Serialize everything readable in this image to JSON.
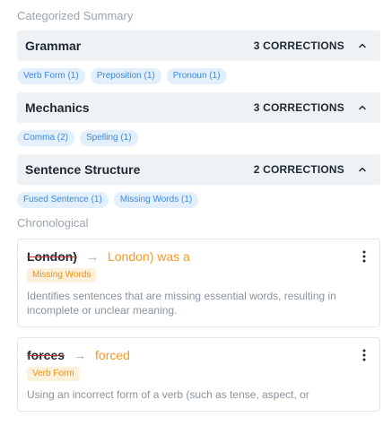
{
  "summary": {
    "heading": "Categorized Summary",
    "categories": [
      {
        "title": "Grammar",
        "count": "3 CORRECTIONS",
        "chips": [
          "Verb Form (1)",
          "Preposition (1)",
          "Pronoun (1)"
        ]
      },
      {
        "title": "Mechanics",
        "count": "3 CORRECTIONS",
        "chips": [
          "Comma (2)",
          "Spelling (1)"
        ]
      },
      {
        "title": "Sentence Structure",
        "count": "2 CORRECTIONS",
        "chips": [
          "Fused Sentence (1)",
          "Missing Words (1)"
        ]
      }
    ]
  },
  "chronological": {
    "heading": "Chronological",
    "items": [
      {
        "original": "London)",
        "replacement": "London) was a",
        "tag": "Missing Words",
        "description": "Identifies sentences that are missing essential words, resulting in incomplete or unclear meaning."
      },
      {
        "original": "forces",
        "replacement": "forced",
        "tag": "Verb Form",
        "description": "Using an incorrect form of a verb (such as tense, aspect, or"
      }
    ]
  },
  "colors": {
    "accent_blue": "#3b8ad8",
    "accent_orange": "#f39a1e",
    "header_bg": "#eef2f5"
  },
  "icons": {
    "collapse": "chevron-up-icon",
    "arrow": "arrow-right-icon",
    "menu": "more-vertical-icon"
  }
}
